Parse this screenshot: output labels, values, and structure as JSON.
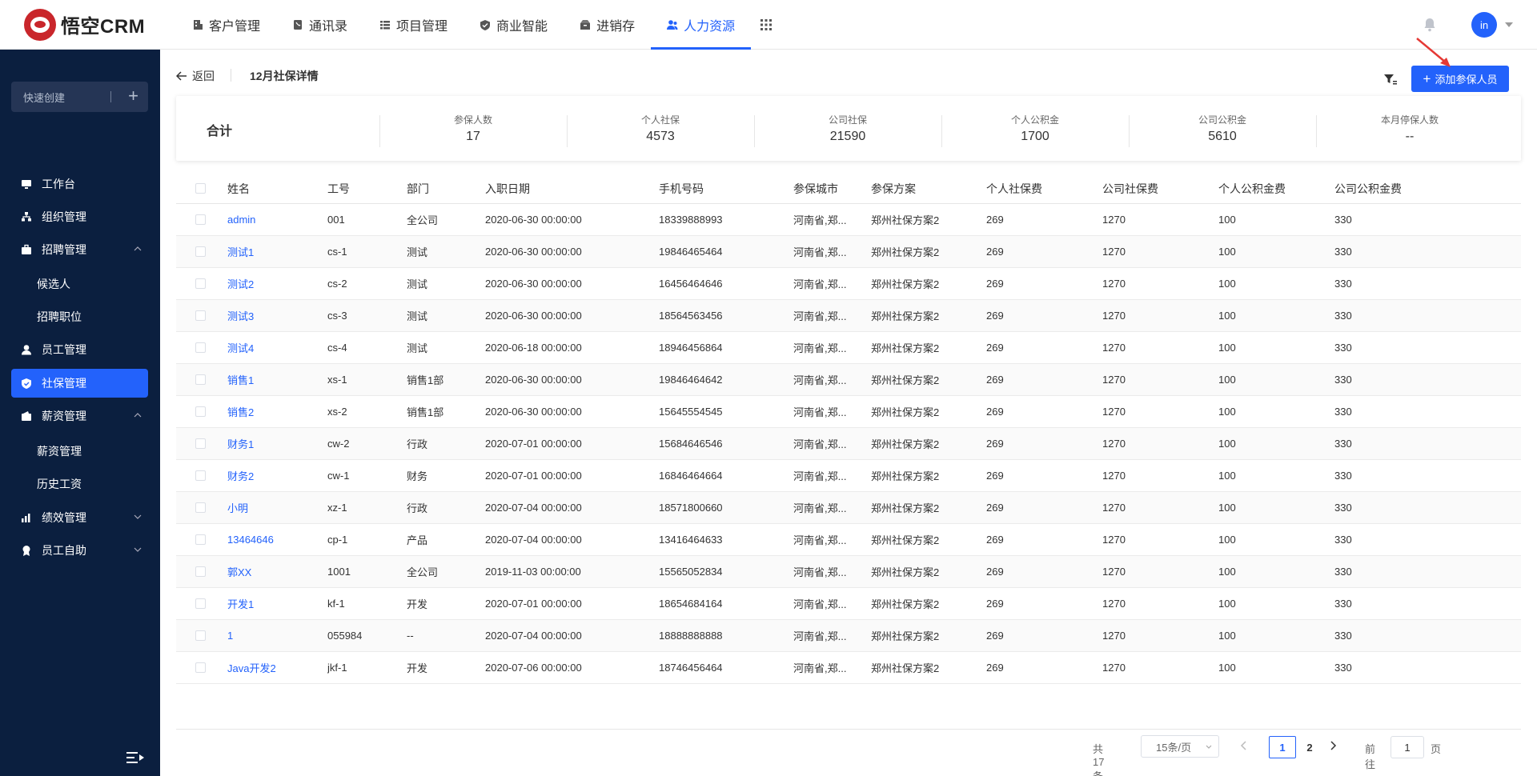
{
  "app": {
    "logo_text": "悟空CRM"
  },
  "topnav": {
    "items": [
      {
        "label": "客户管理",
        "icon": "building-icon"
      },
      {
        "label": "通讯录",
        "icon": "phone-book-icon"
      },
      {
        "label": "项目管理",
        "icon": "list-icon"
      },
      {
        "label": "商业智能",
        "icon": "shield-chart-icon"
      },
      {
        "label": "进销存",
        "icon": "inventory-icon"
      },
      {
        "label": "人力资源",
        "icon": "people-icon",
        "active": true
      }
    ],
    "avatar_text": "in"
  },
  "sidebar": {
    "quick_create": "快速创建",
    "items": [
      {
        "label": "工作台",
        "icon": "monitor-icon"
      },
      {
        "label": "组织管理",
        "icon": "org-icon"
      },
      {
        "label": "招聘管理",
        "icon": "briefcase-icon",
        "expanded": true
      },
      {
        "label": "候选人"
      },
      {
        "label": "招聘职位"
      },
      {
        "label": "员工管理",
        "icon": "user-icon"
      },
      {
        "label": "社保管理",
        "icon": "shield-icon",
        "active": true
      },
      {
        "label": "薪资管理",
        "icon": "wallet-icon",
        "expanded": true
      },
      {
        "label": "薪资管理"
      },
      {
        "label": "历史工资"
      },
      {
        "label": "绩效管理",
        "icon": "chart-icon",
        "expanded": false
      },
      {
        "label": "员工自助",
        "icon": "badge-icon",
        "expanded": false
      }
    ]
  },
  "header": {
    "back_label": "返回",
    "title": "12月社保详情",
    "add_button": "添加参保人员"
  },
  "summary": {
    "total_label": "合计",
    "cols": [
      {
        "label": "参保人数",
        "value": "17"
      },
      {
        "label": "个人社保",
        "value": "4573"
      },
      {
        "label": "公司社保",
        "value": "21590"
      },
      {
        "label": "个人公积金",
        "value": "1700"
      },
      {
        "label": "公司公积金",
        "value": "5610"
      },
      {
        "label": "本月停保人数",
        "value": "--"
      }
    ]
  },
  "table": {
    "columns": [
      "姓名",
      "工号",
      "部门",
      "入职日期",
      "手机号码",
      "参保城市",
      "参保方案",
      "个人社保费",
      "公司社保费",
      "个人公积金费",
      "公司公积金费"
    ],
    "rows": [
      [
        "admin",
        "001",
        "全公司",
        "2020-06-30 00:00:00",
        "18339888993",
        "河南省,郑...",
        "郑州社保方案2",
        "269",
        "1270",
        "100",
        "330"
      ],
      [
        "测试1",
        "cs-1",
        "测试",
        "2020-06-30 00:00:00",
        "19846465464",
        "河南省,郑...",
        "郑州社保方案2",
        "269",
        "1270",
        "100",
        "330"
      ],
      [
        "测试2",
        "cs-2",
        "测试",
        "2020-06-30 00:00:00",
        "16456464646",
        "河南省,郑...",
        "郑州社保方案2",
        "269",
        "1270",
        "100",
        "330"
      ],
      [
        "测试3",
        "cs-3",
        "测试",
        "2020-06-30 00:00:00",
        "18564563456",
        "河南省,郑...",
        "郑州社保方案2",
        "269",
        "1270",
        "100",
        "330"
      ],
      [
        "测试4",
        "cs-4",
        "测试",
        "2020-06-18 00:00:00",
        "18946456864",
        "河南省,郑...",
        "郑州社保方案2",
        "269",
        "1270",
        "100",
        "330"
      ],
      [
        "销售1",
        "xs-1",
        "销售1部",
        "2020-06-30 00:00:00",
        "19846464642",
        "河南省,郑...",
        "郑州社保方案2",
        "269",
        "1270",
        "100",
        "330"
      ],
      [
        "销售2",
        "xs-2",
        "销售1部",
        "2020-06-30 00:00:00",
        "15645554545",
        "河南省,郑...",
        "郑州社保方案2",
        "269",
        "1270",
        "100",
        "330"
      ],
      [
        "财务1",
        "cw-2",
        "行政",
        "2020-07-01 00:00:00",
        "15684646546",
        "河南省,郑...",
        "郑州社保方案2",
        "269",
        "1270",
        "100",
        "330"
      ],
      [
        "财务2",
        "cw-1",
        "财务",
        "2020-07-01 00:00:00",
        "16846464664",
        "河南省,郑...",
        "郑州社保方案2",
        "269",
        "1270",
        "100",
        "330"
      ],
      [
        "小明",
        "xz-1",
        "行政",
        "2020-07-04 00:00:00",
        "18571800660",
        "河南省,郑...",
        "郑州社保方案2",
        "269",
        "1270",
        "100",
        "330"
      ],
      [
        "13464646",
        "cp-1",
        "产品",
        "2020-07-04 00:00:00",
        "13416464633",
        "河南省,郑...",
        "郑州社保方案2",
        "269",
        "1270",
        "100",
        "330"
      ],
      [
        "郭XX",
        "1001",
        "全公司",
        "2019-11-03 00:00:00",
        "15565052834",
        "河南省,郑...",
        "郑州社保方案2",
        "269",
        "1270",
        "100",
        "330"
      ],
      [
        "开发1",
        "kf-1",
        "开发",
        "2020-07-01 00:00:00",
        "18654684164",
        "河南省,郑...",
        "郑州社保方案2",
        "269",
        "1270",
        "100",
        "330"
      ],
      [
        "1",
        "055984",
        "--",
        "2020-07-04 00:00:00",
        "18888888888",
        "河南省,郑...",
        "郑州社保方案2",
        "269",
        "1270",
        "100",
        "330"
      ],
      [
        "Java开发2",
        "jkf-1",
        "开发",
        "2020-07-06 00:00:00",
        "18746456464",
        "河南省,郑...",
        "郑州社保方案2",
        "269",
        "1270",
        "100",
        "330"
      ]
    ]
  },
  "pagination": {
    "total": "共 17 条",
    "page_size": "15条/页",
    "pages": [
      "1",
      "2"
    ],
    "current": "1",
    "goto_label": "前往",
    "goto_value": "1",
    "page_label": "页"
  },
  "colors": {
    "accent": "#2362fb",
    "sidebar_bg": "#0b1f3f"
  }
}
